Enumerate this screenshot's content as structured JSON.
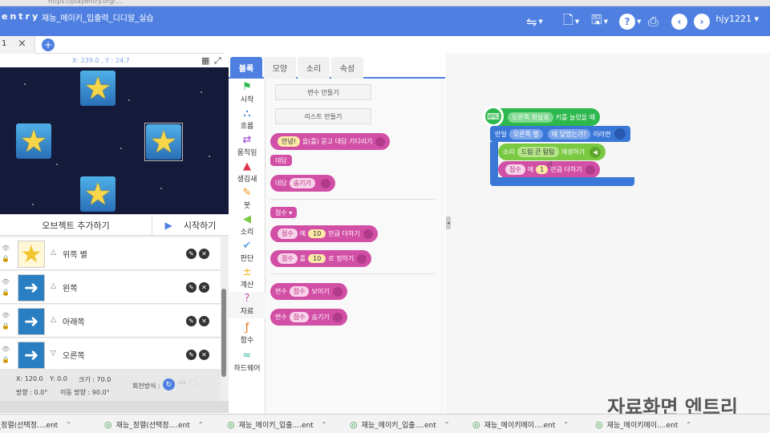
{
  "header": {
    "logo": "entry",
    "project_title": "재능_메이키_입출력_디디알_실습",
    "username": "hjy1221"
  },
  "tabs": {
    "first_label": "1"
  },
  "stage": {
    "coords": "X: 239.0 , Y : 24.7"
  },
  "object_bar": {
    "add_object": "오브젝트 추가하기",
    "start": "시작하기"
  },
  "objects": [
    {
      "name": "위쪽 별",
      "thumb": "star"
    },
    {
      "name": "왼쪽",
      "thumb": "arrow"
    },
    {
      "name": "아래쪽",
      "thumb": "arrow"
    },
    {
      "name": "오른쪽",
      "thumb": "arrow"
    }
  ],
  "object_props": {
    "x": "X: 120.0",
    "y": "Y: 0.0",
    "size": "크기 : 70.0",
    "direction": "방향 : 0.0°",
    "move_direction": "이동 방향 : 90.0°",
    "rotation_mode": "회전방식 :"
  },
  "block_tabs": [
    "블록",
    "모양",
    "소리",
    "속성"
  ],
  "categories": [
    {
      "label": "시작",
      "icon": "flag-icon",
      "color": "#2db84d"
    },
    {
      "label": "흐름",
      "icon": "flow-icon",
      "color": "#3a78d8"
    },
    {
      "label": "움직임",
      "icon": "move-icon",
      "color": "#9b3bd1"
    },
    {
      "label": "생김새",
      "icon": "shapes-icon",
      "color": "#e0324b"
    },
    {
      "label": "붓",
      "icon": "brush-icon",
      "color": "#f38a1e"
    },
    {
      "label": "소리",
      "icon": "sound-icon",
      "color": "#7ac943"
    },
    {
      "label": "판단",
      "icon": "check-icon",
      "color": "#63a6e8"
    },
    {
      "label": "계산",
      "icon": "calc-icon",
      "color": "#f4b41a"
    },
    {
      "label": "자료",
      "icon": "question-icon",
      "color": "#d24fa6"
    },
    {
      "label": "함수",
      "icon": "function-icon",
      "color": "#e8731e"
    },
    {
      "label": "하드웨어",
      "icon": "hardware-icon",
      "color": "#29b3a0"
    }
  ],
  "palette": {
    "make_variable": "변수 만들기",
    "make_list": "리스트 만들기",
    "ask": {
      "pre": "안녕!",
      "post": "을(를) 묻고 대답 기다리기"
    },
    "answer": "대답",
    "hide_answer": {
      "pre": "대답",
      "mid": "숨기기"
    },
    "score_var": "점수",
    "add_to_var": {
      "var": "점수",
      "mid": "에",
      "num": "10",
      "post": "만큼 더하기"
    },
    "set_var": {
      "var": "점수",
      "mid": "를",
      "num": "10",
      "post": "로 정하기"
    },
    "show_var": {
      "pre": "변수",
      "var": "점수",
      "post": "보이기"
    },
    "hide_var": {
      "pre": "변수",
      "var": "점수",
      "post": "숨기기"
    }
  },
  "workspace": {
    "hat": {
      "icon": "keyboard-icon",
      "key": "오른쪽 화살표",
      "post": "키를 눌렀을 때"
    },
    "if": {
      "pre": "만일",
      "obj": "오른쪽 별",
      "cond": "에 닿았는가?",
      "post": "이라면"
    },
    "sound": {
      "pre": "소리",
      "name": "드럼 큰 탐탐",
      "post": "재생하기"
    },
    "add": {
      "var": "점수",
      "mid": "에",
      "num": "1",
      "post": "만큼 더하기"
    },
    "watermark": "자료화면 엔트리"
  },
  "taskbar": [
    "재능_정렬(선택정....ent",
    "재능_정렬(선택정....ent",
    "재능_메이키_입출....ent",
    "재능_메이키_입출....ent",
    "재능_메이키메이....ent",
    "재능_메이키메이....ent"
  ]
}
